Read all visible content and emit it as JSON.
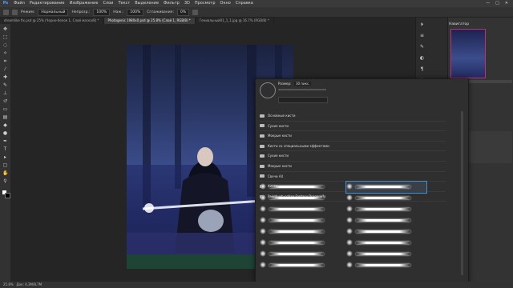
{
  "menu": {
    "logo": "Ps",
    "items": [
      "Файл",
      "Редактирование",
      "Изображение",
      "Слои",
      "Текст",
      "Выделение",
      "Фильтр",
      "3D",
      "Просмотр",
      "Окно",
      "Справка"
    ],
    "window_controls": [
      "—",
      "□",
      "✕"
    ]
  },
  "options": {
    "mode_label": "Режим:",
    "mode_value": "Нормальный",
    "opacity_label": "Непрозр.:",
    "opacity_value": "100%",
    "flow_label": "Наж.:",
    "flow_value": "100%",
    "smoothing_label": "Сглаживание:",
    "smoothing_value": "0%"
  },
  "tabs": [
    {
      "label": "dreamlike fix.psd @ 25% (Черно-белое 1, Слой маска/8) *",
      "active": false
    },
    {
      "label": "Photogenic 1980x0.psd @ 25.8% (Слой 1, RGB/8) *",
      "active": true
    },
    {
      "label": "Гениальный01_1_1.jpg @ 16.7% (RGB/8) *",
      "active": false
    }
  ],
  "status": {
    "zoom": "25.8%",
    "doc": "Док: 4,3M/8,7M"
  },
  "navigator": {
    "title": "Навигатор"
  },
  "brush_panel": {
    "size_label": "Размер:",
    "size_value": "30 пикс.",
    "folders": [
      "Основные кисти",
      "Сухие кисти",
      "Мокрые кисти",
      "Кисти со специальными эффектами",
      "Сухие кисти",
      "Мокрые кисти",
      "Свечи А4",
      "Кисти",
      "Paintbush-cofrse Fantasy DragonVfx"
    ]
  },
  "icons": {
    "brush": "brush-icon",
    "folder": "folder-icon",
    "gear": "gear-icon",
    "search": "search-icon"
  },
  "colors": {
    "accent": "#3d8fd6",
    "panel": "#2f2f2f",
    "nav_frame": "#c0307a"
  }
}
